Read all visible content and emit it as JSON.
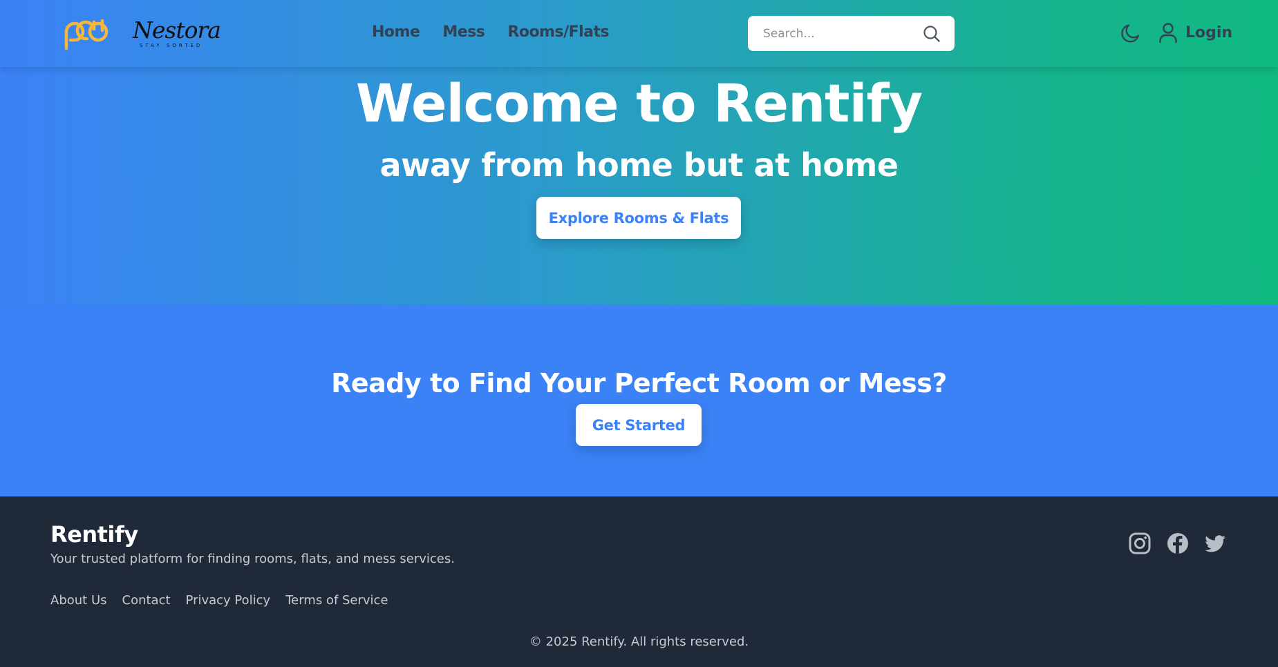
{
  "header": {
    "brand_name": "Nestora",
    "brand_tagline": "STAY SORTED",
    "nav": [
      "Home",
      "Mess",
      "Rooms/Flats"
    ],
    "search_placeholder": "Search...",
    "login_label": "Login"
  },
  "hero": {
    "title": "Welcome to Rentify",
    "subtitle": "away from home but at home",
    "button_label": "Explore Rooms & Flats"
  },
  "cta": {
    "title": "Ready to Find Your Perfect Room or Mess?",
    "button_label": "Get Started"
  },
  "footer": {
    "brand": "Rentify",
    "tagline": "Your trusted platform for finding rooms, flats, and mess services.",
    "links": [
      "About Us",
      "Contact",
      "Privacy Policy",
      "Terms of Service"
    ],
    "copyright": "© 2025 Rentify. All rights reserved.",
    "social_icons": [
      "instagram-icon",
      "facebook-icon",
      "twitter-icon"
    ]
  },
  "colors": {
    "primary_blue": "#3b82f6",
    "accent_green": "#10b981",
    "logo_yellow": "#f5b73b",
    "footer_bg": "#1f2937",
    "nav_text": "#334155"
  }
}
